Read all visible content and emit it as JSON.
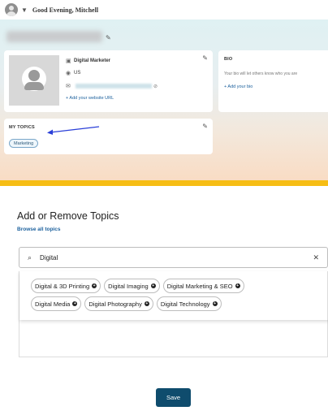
{
  "header": {
    "greeting": "Good Evening, Mitchell"
  },
  "profile": {
    "job_title": "Digital Marketer",
    "location": "US",
    "add_website": "+ Add your website URL"
  },
  "bio": {
    "title": "BIO",
    "description": "Your bio will let others know who you are",
    "add_bio": "+ Add your bio"
  },
  "my_topics": {
    "title": "MY TOPICS",
    "items": [
      "Marketing"
    ]
  },
  "add_topics": {
    "title": "Add or Remove Topics",
    "browse_label": "Browse all topics",
    "search_value": "Digital",
    "suggestions": [
      "Digital & 3D Printing",
      "Digital Imaging",
      "Digital Marketing & SEO",
      "Digital Media",
      "Digital Photography",
      "Digital Technology"
    ]
  },
  "actions": {
    "save_label": "Save"
  },
  "colors": {
    "accent": "#1a5f9c",
    "save_button": "#0f4c6d",
    "gold_bar": "#f6bd14",
    "arrow": "#2a3fd8"
  }
}
